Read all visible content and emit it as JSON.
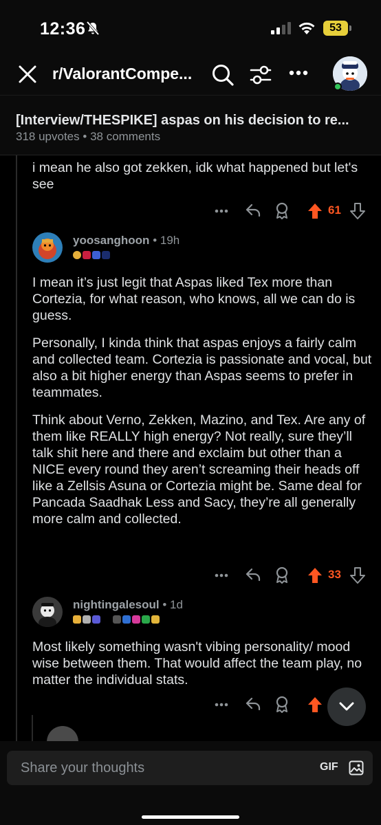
{
  "status_bar": {
    "time": "12:36",
    "battery": "53"
  },
  "header": {
    "subreddit": "r/ValorantCompe..."
  },
  "post": {
    "title": "[Interview/THESPIKE] aspas on his decision to re...",
    "upvotes": "318 upvotes",
    "separator": "•",
    "comments": "38 comments"
  },
  "comments": [
    {
      "body": [
        "i mean he also got zekken, idk what happened but let's see"
      ],
      "score": "61"
    },
    {
      "author": "yoosanghoon",
      "age": "• 19h",
      "body": [
        "I mean it’s just legit that Aspas liked Tex more than Cortezia, for what reason, who knows, all we can do is guess.",
        "Personally, I kinda think that aspas enjoys a fairly calm and collected team. Cortezia is passionate and vocal, but also a bit higher energy than Aspas seems to prefer in teammates.",
        "Think about Verno, Zekken, Mazino, and Tex. Are any of them like REALLY high energy? Not really, sure they’ll talk shit here and there and exclaim but other than a NICE every round they aren’t screaming their heads off like a Zellsis Asuna or Cortezia might be. Same deal for Pancada Saadhak Less and Sacy, they’re all generally more calm and collected."
      ],
      "score": "33"
    },
    {
      "author": "nightingalesoul",
      "age": "• 1d",
      "body": [
        "Most likely something wasn't vibing personality/ mood wise between them. That would affect the team play, no matter the individual stats."
      ]
    }
  ],
  "composer": {
    "placeholder": "Share your thoughts",
    "gif_label": "GIF"
  },
  "colors": {
    "accent_orange": "#ff5722",
    "background": "#000000",
    "battery": "#e7cf3a"
  },
  "icons": [
    "bell-off-icon",
    "signal-icon",
    "wifi-icon",
    "close-icon",
    "search-icon",
    "filter-icon",
    "more-icon",
    "reply-icon",
    "award-icon",
    "upvote-icon",
    "downvote-icon",
    "chevron-down-icon",
    "image-icon"
  ]
}
